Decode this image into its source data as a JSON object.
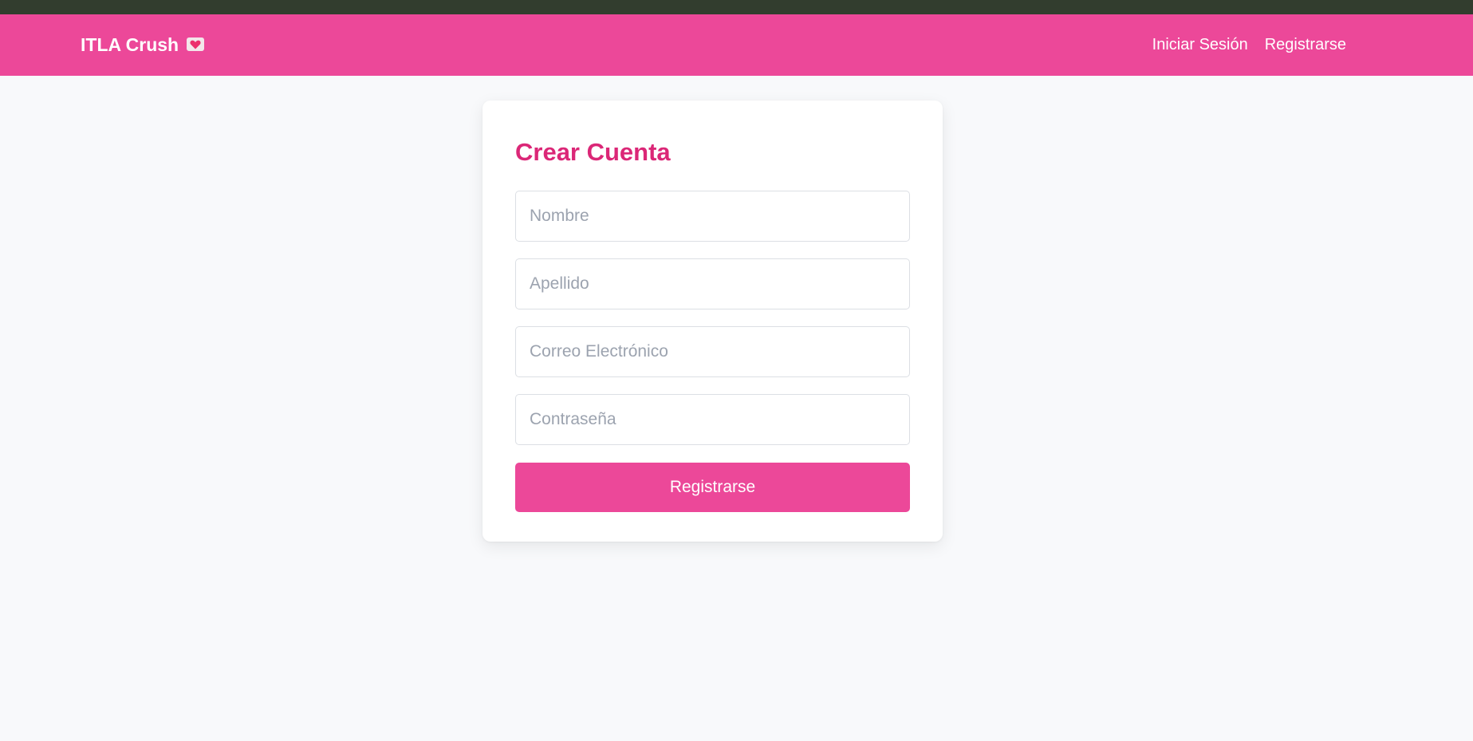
{
  "navbar": {
    "brand": "ITLA Crush",
    "brand_icon": "heart-letter-icon",
    "links": [
      {
        "label": "Iniciar Sesión"
      },
      {
        "label": "Registrarse"
      }
    ],
    "color": "#ec4899"
  },
  "form": {
    "title": "Crear Cuenta",
    "fields": [
      {
        "placeholder": "Nombre",
        "value": ""
      },
      {
        "placeholder": "Apellido",
        "value": ""
      },
      {
        "placeholder": "Correo Electrónico",
        "value": ""
      },
      {
        "placeholder": "Contraseña",
        "value": ""
      }
    ],
    "submit_label": "Registrarse",
    "title_color": "#db2777"
  }
}
